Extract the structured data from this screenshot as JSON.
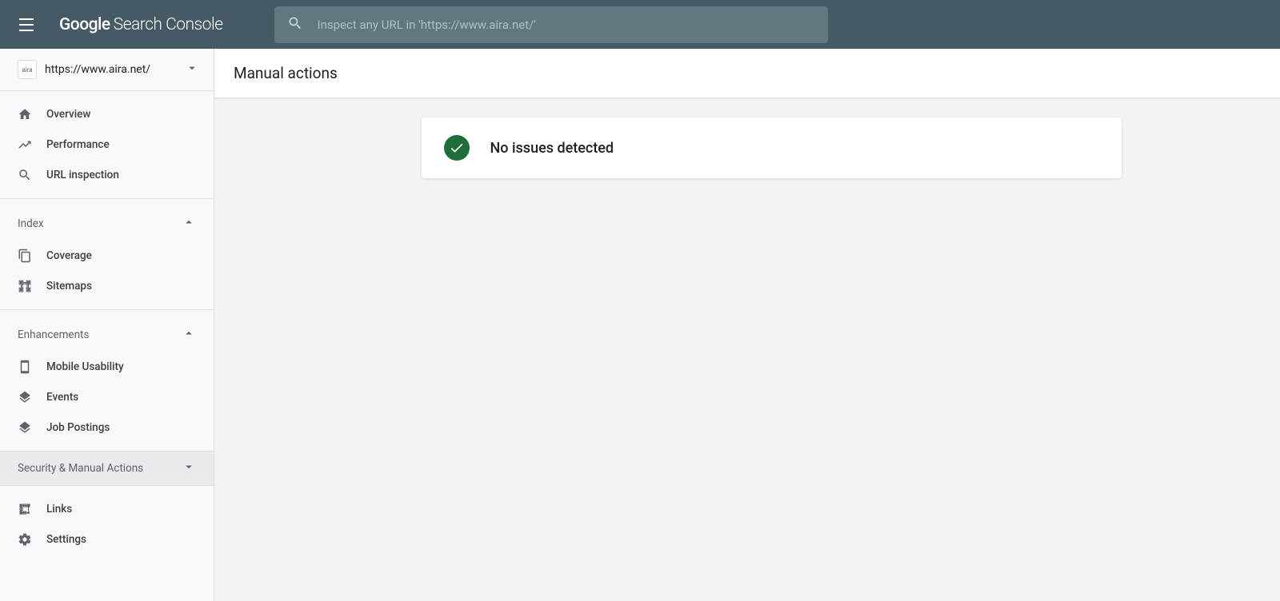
{
  "header": {
    "logo_google": "Google",
    "logo_sc": "Search Console",
    "search_placeholder": "Inspect any URL in 'https://www.aira.net/'"
  },
  "sidebar": {
    "property": {
      "favicon_text": "aira",
      "url": "https://www.aira.net/"
    },
    "nav_main": [
      {
        "label": "Overview",
        "icon": "home"
      },
      {
        "label": "Performance",
        "icon": "trending"
      },
      {
        "label": "URL inspection",
        "icon": "search"
      }
    ],
    "section_index": {
      "label": "Index",
      "items": [
        {
          "label": "Coverage",
          "icon": "copy"
        },
        {
          "label": "Sitemaps",
          "icon": "sitemap"
        }
      ]
    },
    "section_enhancements": {
      "label": "Enhancements",
      "items": [
        {
          "label": "Mobile Usability",
          "icon": "mobile"
        },
        {
          "label": "Events",
          "icon": "layers"
        },
        {
          "label": "Job Postings",
          "icon": "layers"
        }
      ]
    },
    "section_security": {
      "label": "Security & Manual Actions"
    },
    "nav_bottom": [
      {
        "label": "Links",
        "icon": "links"
      },
      {
        "label": "Settings",
        "icon": "settings"
      }
    ]
  },
  "content": {
    "title": "Manual actions",
    "status_message": "No issues detected"
  }
}
